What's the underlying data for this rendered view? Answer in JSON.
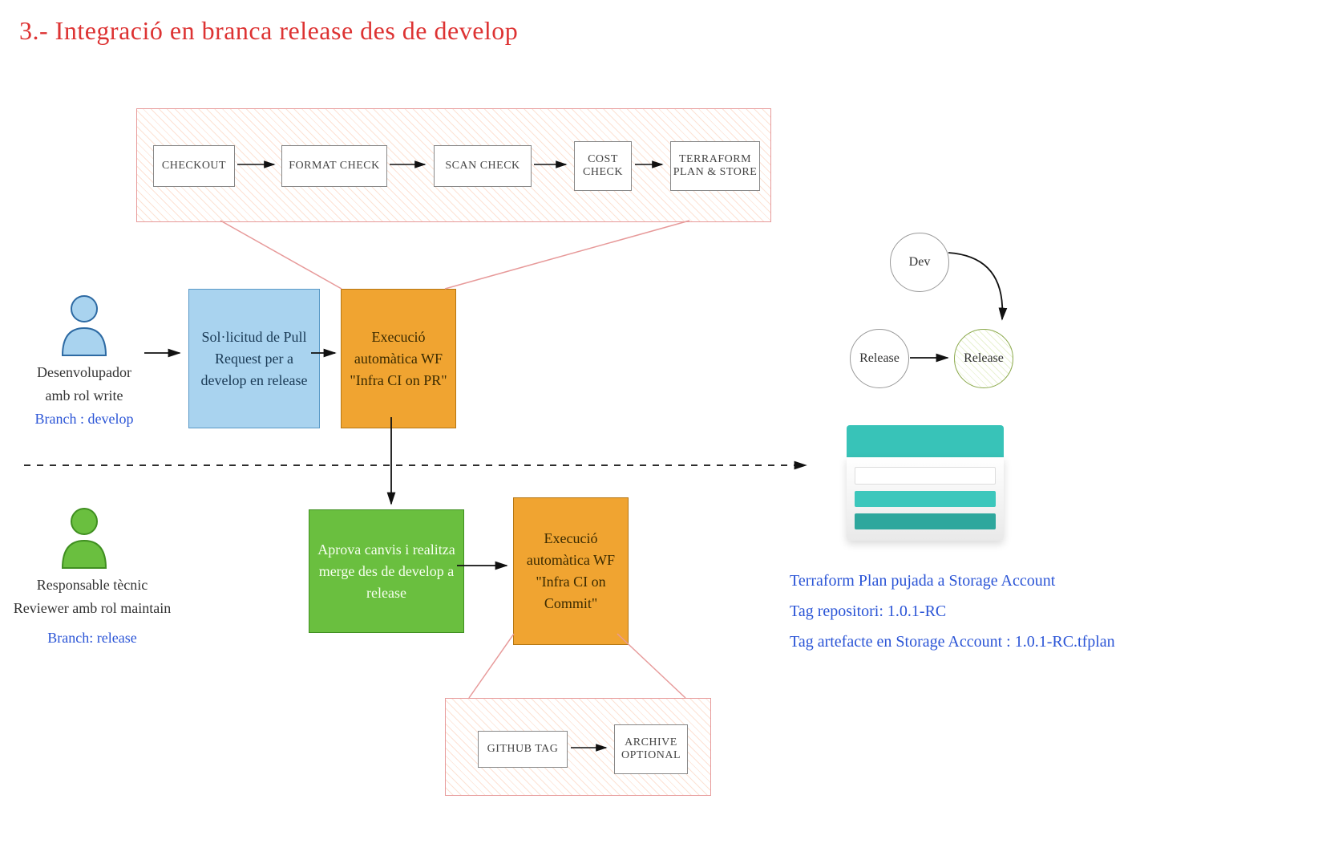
{
  "title": "3.- Integració en branca release des de develop",
  "panel_top": {
    "steps": [
      "CHECKOUT",
      "FORMAT CHECK",
      "SCAN CHECK",
      "COST CHECK",
      "TERRAFORM PLAN & STORE"
    ]
  },
  "panel_bottom": {
    "steps": [
      "GITHUB TAG",
      "ARCHIVE OPTIONAL"
    ]
  },
  "actors": {
    "dev": {
      "line1": "Desenvolupador",
      "line2": "amb rol write",
      "branch": "Branch : develop"
    },
    "rev": {
      "line1": "Responsable tècnic",
      "line2": "Reviewer amb rol maintain",
      "branch": "Branch: release"
    }
  },
  "blocks": {
    "pr": "Sol·licitud de Pull Request per a develop en release",
    "wf_pr": "Execució automàtica WF \"Infra CI on PR\"",
    "approve": "Aprova canvis i realitza merge des de develop a release",
    "wf_commit": "Execució automàtica WF \"Infra CI on Commit\""
  },
  "branches": {
    "dev": "Dev",
    "release": "Release"
  },
  "notes": {
    "l1": "Terraform Plan pujada a Storage Account",
    "l2": "Tag repositori: 1.0.1-RC",
    "l3": "Tag artefacte en Storage Account : 1.0.1-RC.tfplan"
  }
}
